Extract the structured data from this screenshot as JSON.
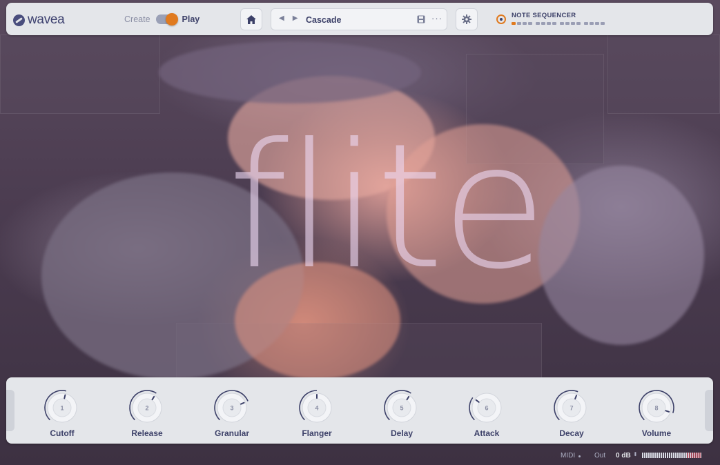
{
  "app": {
    "logo_text": "wavea"
  },
  "mode_switch": {
    "left_label": "Create",
    "right_label": "Play",
    "active": "Play"
  },
  "preset": {
    "name": "Cascade",
    "more_label": "···"
  },
  "sequencer": {
    "label": "NOTE SEQUENCER",
    "steps_total": 16,
    "active_step": 1
  },
  "artwork": {
    "wordmark": "flite"
  },
  "knobs": [
    {
      "number": "1",
      "label": "Cutoff",
      "value": 0.55
    },
    {
      "number": "2",
      "label": "Release",
      "value": 0.62
    },
    {
      "number": "3",
      "label": "Granular",
      "value": 0.75
    },
    {
      "number": "4",
      "label": "Flanger",
      "value": 0.5
    },
    {
      "number": "5",
      "label": "Delay",
      "value": 0.62
    },
    {
      "number": "6",
      "label": "Attack",
      "value": 0.3
    },
    {
      "number": "7",
      "label": "Decay",
      "value": 0.58
    },
    {
      "number": "8",
      "label": "Volume",
      "value": 0.9
    }
  ],
  "status": {
    "midi_label": "MIDI",
    "out_label": "Out",
    "out_value": "0 dB"
  },
  "colors": {
    "accent": "#e07a1f",
    "text_primary": "#3c4068",
    "panel": "#e4e6ea"
  }
}
